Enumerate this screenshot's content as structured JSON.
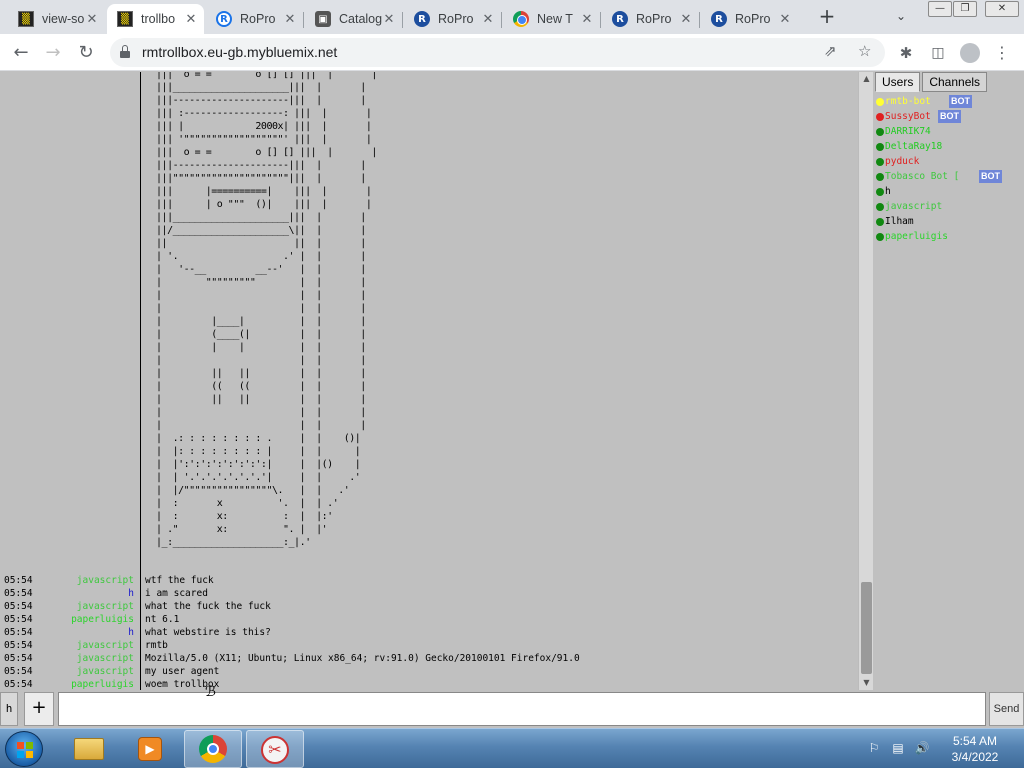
{
  "browser": {
    "tabs": [
      {
        "title": "view-so",
        "icon": "trollbox-icon",
        "active": false
      },
      {
        "title": "trollbo",
        "icon": "trollbox-icon",
        "active": true
      },
      {
        "title": "RoPro",
        "icon": "ropro-icon",
        "active": false
      },
      {
        "title": "Catalog",
        "icon": "catalog-icon",
        "active": false
      },
      {
        "title": "RoPro",
        "icon": "ropro-icon",
        "active": false
      },
      {
        "title": "New T",
        "icon": "chrome-icon",
        "active": false
      },
      {
        "title": "RoPro",
        "icon": "ropro-icon",
        "active": false
      },
      {
        "title": "RoPro",
        "icon": "ropro-icon",
        "active": false
      }
    ],
    "url": "rmtrollbox.eu-gb.mybluemix.net"
  },
  "colors": {
    "nick_javascript": "#3ec83e",
    "nick_h": "#1a1acc",
    "nick_paperluigis": "#2bd42b",
    "page_bg": "#c0c0c0",
    "bot_badge": "#6f86d8"
  },
  "ascii_art": "  |||  o = =        o [] [] |||  |       |\n  |||_____________________|||  |       |\n  |||---------------------|||  |       |\n  ||| :------------------: |||  |       |\n  ||| |             2000x| |||  |       |\n  ||| '\"\"\"\"\"\"\"\"\"\"\"\"\"\"\"\"\"\"' |||  |       |\n  |||  o = =        o [] [] |||  |       |\n  |||---------------------|||  |       |\n  |||\"\"\"\"\"\"\"\"\"\"\"\"\"\"\"\"\"\"\"\"\"|||  |       |\n  |||      |==========|    |||  |       |\n  |||      | o \"\"\"  ()|    |||  |       |\n  |||_____________________|||  |       |\n  ||/_____________________\\||  |       |\n  ||                       ||  |       |\n  | '.                   .' |  |       |\n  |   '--__         __--'   |  |       |\n  |        \"\"\"\"\"\"\"\"\"        |  |       |\n  |                         |  |       |\n  |                         |  |       |\n  |         |____|          |  |       |\n  |         (____(|         |  |       |\n  |         |    |          |  |       |\n  |                         |  |       |\n  |         ||   ||         |  |       |\n  |         ((   ((         |  |       |\n  |         ||   ||         |  |       |\n  |                         |  |       |\n  |                         |  |       |\n  |  .: : : : : : : : .     |  |    ()|\n  |  |: : : : : : : : |     |  |      |\n  |  |':':':':':':':':|     |  |()    |\n  |  | '.'.'.'.'.'.'.'|     |  |     .'\n  |  |/\"\"\"\"\"\"\"\"\"\"\"\"\"\"\"\"\\.   |  |   .'\n  |  :       x          '.  |  | .'\n  |  :       x:          :  |  |:'\n  | .\"       x:          \". |  |'\n  |_:____________________:_|.'",
  "messages": [
    {
      "time": "05:54",
      "nick": "javascript",
      "color": "#3ec83e",
      "text": "wtf the fuck"
    },
    {
      "time": "05:54",
      "nick": "h",
      "color": "#1a1acc",
      "text": "i am scared"
    },
    {
      "time": "05:54",
      "nick": "javascript",
      "color": "#3ec83e",
      "text": "what the fuck the fuck"
    },
    {
      "time": "05:54",
      "nick": "paperluigis",
      "color": "#2bd42b",
      "text": "nt 6.1"
    },
    {
      "time": "05:54",
      "nick": "h",
      "color": "#1a1acc",
      "text": "what webstire is this?"
    },
    {
      "time": "05:54",
      "nick": "javascript",
      "color": "#3ec83e",
      "text": "rmtb"
    },
    {
      "time": "05:54",
      "nick": "javascript",
      "color": "#3ec83e",
      "text": "Mozilla/5.0 (X11; Ubuntu; Linux x86_64; rv:91.0) Gecko/20100101 Firefox/91.0"
    },
    {
      "time": "05:54",
      "nick": "javascript",
      "color": "#3ec83e",
      "text": "my user agent"
    },
    {
      "time": "05:54",
      "nick": "paperluigis",
      "color": "#2bd42b",
      "text": "woem trollbox"
    }
  ],
  "panel": {
    "tab_users": "Users",
    "tab_channels": "Channels",
    "users": [
      {
        "name": "rmtb-bot",
        "color": "#ffff33",
        "dot": "#ffff33",
        "bot": true,
        "bot_label": "BOT"
      },
      {
        "name": "SussyBot",
        "color": "#e02020",
        "dot": "#e02020",
        "bot": true,
        "bot_label": "BOT"
      },
      {
        "name": "DARRIK74",
        "color": "#22cc22",
        "dot": "#118811",
        "bot": false
      },
      {
        "name": "DeltaRay18",
        "color": "#22cc22",
        "dot": "#118811",
        "bot": false
      },
      {
        "name": "pyduck",
        "color": "#e02020",
        "dot": "#118811",
        "bot": false
      },
      {
        "name": "Tobasco Bot [",
        "color": "#3ec83e",
        "dot": "#118811",
        "bot": true,
        "bot_label": "BOT"
      },
      {
        "name": "h",
        "color": "#000000",
        "dot": "#118811",
        "bot": false
      },
      {
        "name": "javascript",
        "color": "#3ec83e",
        "dot": "#118811",
        "bot": false
      },
      {
        "name": "Ilham",
        "color": "#000000",
        "dot": "#118811",
        "bot": false
      },
      {
        "name": "paperluigis",
        "color": "#2bd42b",
        "dot": "#118811",
        "bot": false
      }
    ]
  },
  "input": {
    "nick": "h",
    "plus": "+",
    "value": "",
    "send": "Send"
  },
  "taskbar": {
    "time": "5:54 AM",
    "date": "3/4/2022"
  }
}
